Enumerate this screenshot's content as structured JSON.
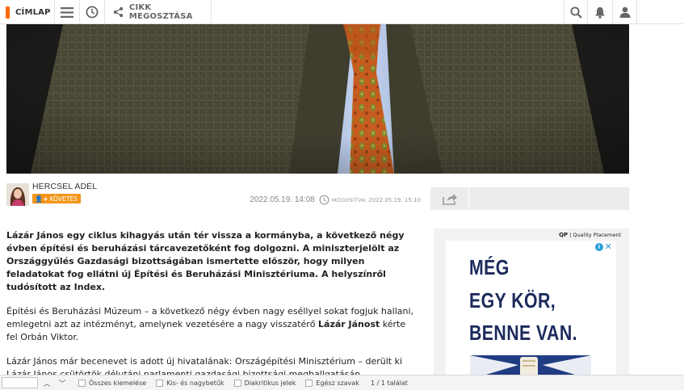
{
  "nav": {
    "home_label": "CÍMLAP",
    "share_label": "CIKK MEGOSZTÁSA",
    "icons": [
      "hamburger-icon",
      "clock-icon",
      "share-icon",
      "search-icon",
      "bell-icon",
      "user-icon"
    ]
  },
  "author": {
    "name": "HERCSEL ADÉL",
    "follow_label": "KÖVETÉS"
  },
  "meta": {
    "published": "2022.05.19. 14:08",
    "modified_label": "MÓDOSÍTVA:",
    "modified": "2022.05.19. 15:10"
  },
  "article": {
    "lead": "Lázár János egy ciklus kihagyás után tér vissza a kormányba, a következő négy évben építési és beruházási tárcavezetőként fog dolgozni. A miniszterjelölt az Országgyűlés Gazdasági bizottságában ismertette először, hogy milyen feladatokat fog ellátni új Építési és Beruházási Minisztériuma. A helyszínről tudósított az Index.",
    "p1_before": "Építési és Beruházási Múzeum – a következő négy évben nagy eséllyel sokat fogjuk hallani, emlegetni azt az intézményt, amelynek vezetésére a nagy visszatérő ",
    "p1_bold": "Lázár Jánost",
    "p1_after": " kérte fel Orbán Viktor.",
    "p2": "Lázár János már becenevet is adott új hivatalának: Országépítési Minisztérium – derült ki Lázár János csütörtök délutáni parlamenti gazdasági bizottsági meghallgatásán."
  },
  "ad": {
    "brand": "QP",
    "tag": "Quality Placement",
    "info": "i",
    "line1": "MÉG",
    "line2": "EGY KÖR,",
    "line3": "BENNE VAN."
  },
  "findbar": {
    "up": "︿",
    "down": "﹀",
    "opt_highlight": "Összes kiemelése",
    "opt_case": "Kis- és nagybetűk",
    "opt_diacritics": "Diakritikus jelek",
    "opt_whole": "Egész szavak",
    "count": "1 / 1 találat"
  },
  "colors": {
    "accent": "#f39519",
    "home_mark": "#ff6a00",
    "ad_navy": "#1c2a5c"
  }
}
